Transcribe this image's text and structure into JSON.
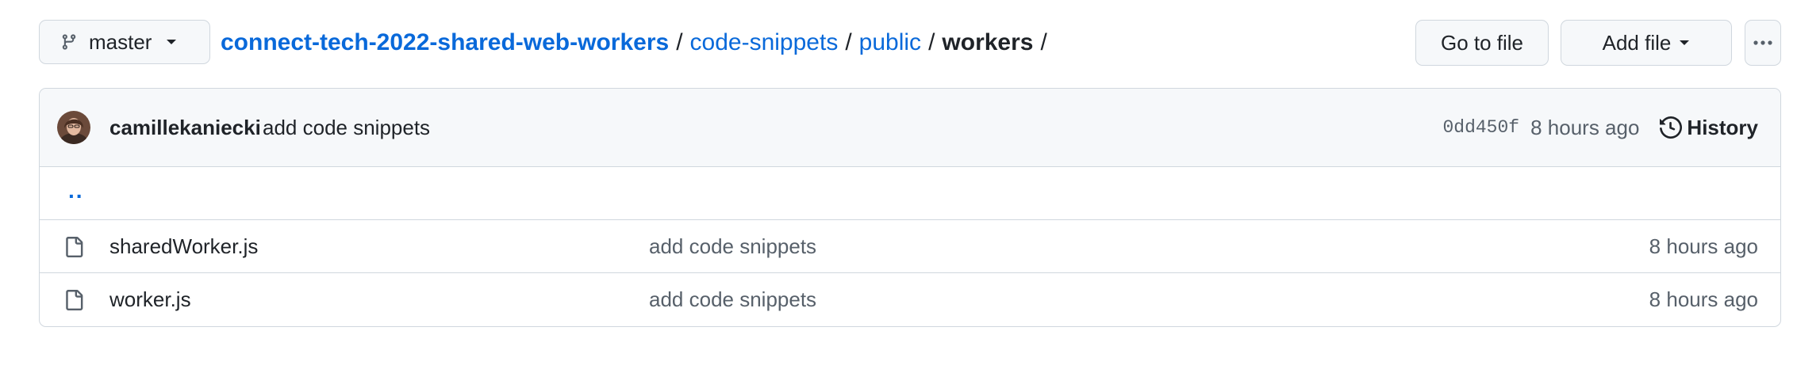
{
  "branch": {
    "name": "master",
    "icon": "git-branch-icon"
  },
  "breadcrumb": {
    "repo": "connect-tech-2022-shared-web-workers",
    "dir1": "code-snippets",
    "dir2": "public",
    "current": "workers",
    "separator": "/"
  },
  "actions": {
    "go_to_file": "Go to file",
    "add_file": "Add file",
    "more_icon": "kebab-horizontal-icon"
  },
  "commit": {
    "author": "camillekaniecki",
    "message": "add code snippets",
    "sha": "0dd450f",
    "time": "8 hours ago",
    "history_label": "History"
  },
  "parent_link": "..",
  "files": [
    {
      "name": "sharedWorker.js",
      "commit_message": "add code snippets",
      "time": "8 hours ago",
      "icon": "file-icon"
    },
    {
      "name": "worker.js",
      "commit_message": "add code snippets",
      "time": "8 hours ago",
      "icon": "file-icon"
    }
  ],
  "colors": {
    "link": "#0969da",
    "border": "#d0d7de",
    "muted": "#57606a",
    "header_bg": "#f6f8fa"
  }
}
